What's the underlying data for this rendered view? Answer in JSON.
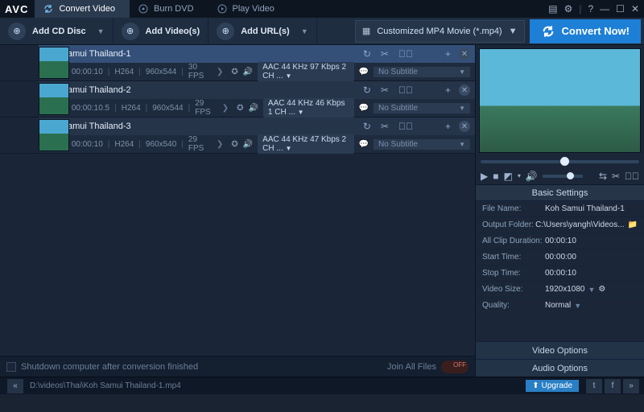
{
  "app": {
    "logo": "AVC"
  },
  "tabs": [
    {
      "label": "Convert Video",
      "icon": "refresh",
      "active": true
    },
    {
      "label": "Burn DVD",
      "icon": "disc",
      "active": false
    },
    {
      "label": "Play Video",
      "icon": "play",
      "active": false
    }
  ],
  "toolbar": {
    "addDisc": "Add CD Disc",
    "addVideo": "Add Video(s)",
    "addUrl": "Add URL(s)",
    "profile": "Customized MP4 Movie (*.mp4)",
    "convert": "Convert Now!"
  },
  "files": [
    {
      "name": "Koh Samui Thailand-1",
      "dur": "00:00:10",
      "vcodec": "H264",
      "res": "960x544",
      "fps": "30 FPS",
      "audio": "AAC 44 KHz 97 Kbps 2 CH ...",
      "sub": "No Subtitle",
      "sel": true
    },
    {
      "name": "Koh Samui Thailand-2",
      "dur": "00:00:10.5",
      "vcodec": "H264",
      "res": "960x544",
      "fps": "29 FPS",
      "audio": "AAC 44 KHz 46 Kbps 1 CH ...",
      "sub": "No Subtitle",
      "sel": false
    },
    {
      "name": "Koh Samui Thailand-3",
      "dur": "00:00:10",
      "vcodec": "H264",
      "res": "960x540",
      "fps": "29 FPS",
      "audio": "AAC 44 KHz 47 Kbps 2 CH ...",
      "sub": "No Subtitle",
      "sel": false
    }
  ],
  "footer": {
    "shutdown": "Shutdown computer after conversion finished",
    "join": "Join All Files"
  },
  "settings": {
    "head": "Basic Settings",
    "rows": {
      "fileNameK": "File Name:",
      "fileNameV": "Koh Samui Thailand-1",
      "outK": "Output Folder:",
      "outV": "C:\\Users\\yangh\\Videos...",
      "durK": "All Clip Duration:",
      "durV": "00:00:10",
      "startK": "Start Time:",
      "startV": "00:00:00",
      "stopK": "Stop Time:",
      "stopV": "00:00:10",
      "sizeK": "Video Size:",
      "sizeV": "1920x1080",
      "qualK": "Quality:",
      "qualV": "Normal"
    },
    "videoOpt": "Video Options",
    "audioOpt": "Audio Options"
  },
  "status": {
    "path": "D:\\videos\\Thai\\Koh Samui Thailand-1.mp4",
    "upgrade": "Upgrade"
  }
}
